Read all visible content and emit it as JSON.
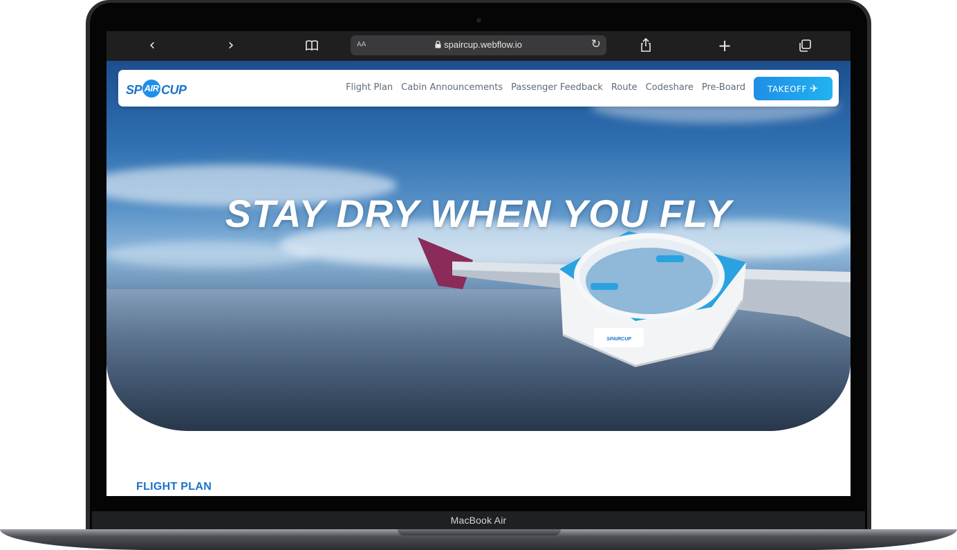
{
  "browser": {
    "url": "spaircup.webflow.io",
    "aa_label": "AA"
  },
  "nav": {
    "logo": {
      "pre": "SP",
      "mid": "AIR",
      "post": "CUP"
    },
    "links": [
      "Flight Plan",
      "Cabin Announcements",
      "Passenger Feedback",
      "Route",
      "Codeshare",
      "Pre-Board"
    ],
    "cta": "TAKEOFF"
  },
  "hero": {
    "title": "STAY DRY WHEN YOU FLY",
    "product_badge": "SPAIRCUP"
  },
  "section": {
    "label": "FLIGHT PLAN"
  },
  "device": {
    "label": "MacBook Air"
  },
  "colors": {
    "brand_blue": "#1a73c8",
    "cta_gradient_start": "#1f8ee6",
    "cta_gradient_end": "#22b2f0",
    "toolbar_bg": "#1f1f1f"
  },
  "icons": [
    "back-icon",
    "forward-icon",
    "bookmarks-icon",
    "lock-icon",
    "reload-icon",
    "share-icon",
    "new-tab-icon",
    "tabs-icon",
    "plane-icon"
  ]
}
